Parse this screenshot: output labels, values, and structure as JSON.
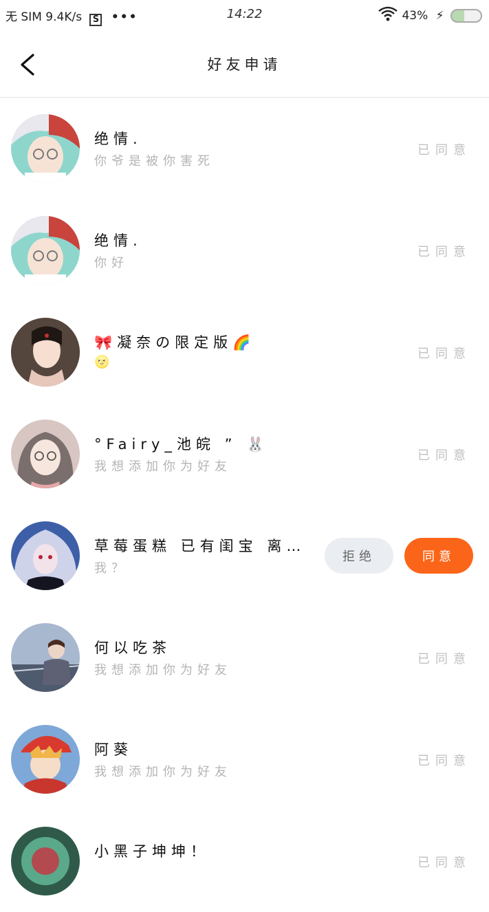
{
  "status_bar": {
    "carrier": "无 SIM",
    "speed": "9.4K/s",
    "app_badge": "S",
    "more": "•••",
    "time": "14:22",
    "battery": "43%",
    "battery_level": 0.43
  },
  "header": {
    "title": "好友申请"
  },
  "requests": [
    {
      "name": "绝情.",
      "message": "你爷是被你害死",
      "status": "已同意"
    },
    {
      "name": "绝情.",
      "message": "你好",
      "status": "已同意"
    },
    {
      "name": "🎀凝奈の限定版🌈",
      "message": "🌝",
      "status": "已同意"
    },
    {
      "name": "°Fairy_池皖 ” 🐰",
      "message": "我想添加你为好友",
      "status": "已同意"
    },
    {
      "name": "草莓蛋糕 已有闺宝 离…",
      "message": "我？",
      "reject_label": "拒绝",
      "accept_label": "同意"
    },
    {
      "name": "何以吃茶",
      "message": "我想添加你为好友",
      "status": "已同意"
    },
    {
      "name": "阿葵",
      "message": "我想添加你为好友",
      "status": "已同意"
    },
    {
      "name": "小黑子坤坤！",
      "message": "",
      "status": "已同意"
    }
  ],
  "colors": {
    "accent": "#fb6519",
    "reject_bg": "#eaedf1",
    "muted_text": "#b5b5b5"
  }
}
